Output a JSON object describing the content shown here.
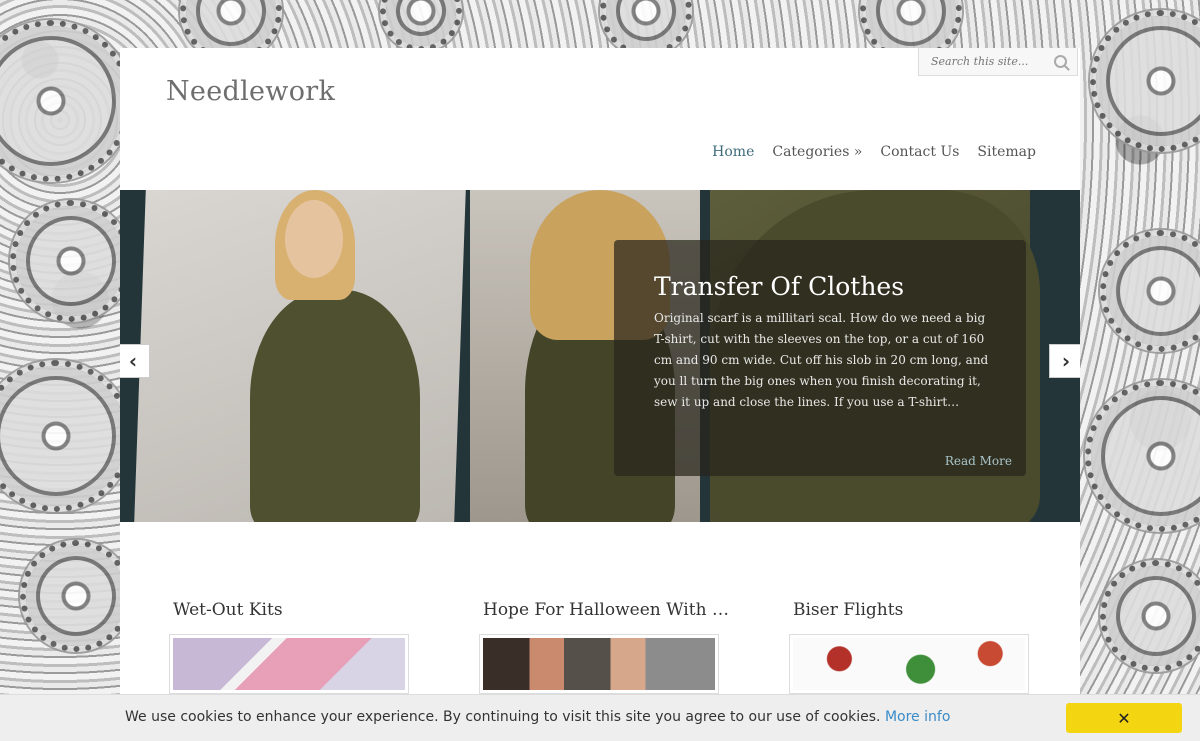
{
  "site": {
    "title": "Needlework"
  },
  "search": {
    "placeholder": "Search this site..."
  },
  "nav": {
    "items": [
      "Home",
      "Categories »",
      "Contact Us",
      "Sitemap"
    ],
    "active": "Home"
  },
  "slider": {
    "title": "Transfer Of Clothes",
    "excerpt": "Original scarf is a millitari scal. How do we need a big T-shirt, cut with the sleeves on the top, or a cut of 160 cm and 90 cm wide. Cut off his slob in 20 cm long, and you ll turn the big ones when you finish decorating it, sew it up and close the lines. If you use a T-shirt…",
    "read_more": "Read More",
    "prev_icon": "‹",
    "next_icon": "›"
  },
  "posts": [
    {
      "title": "Wet-Out Kits"
    },
    {
      "title": "Hope For Halloween With His H..."
    },
    {
      "title": "Biser Flights"
    }
  ],
  "cookie": {
    "text": "We use cookies to enhance your experience. By continuing to visit this site you agree to our use of cookies.",
    "more": "More info",
    "close": "✕"
  },
  "colors": {
    "nav_active": "#3e6b7a",
    "cookie_button": "#f3d511",
    "link": "#3a8bc8"
  }
}
